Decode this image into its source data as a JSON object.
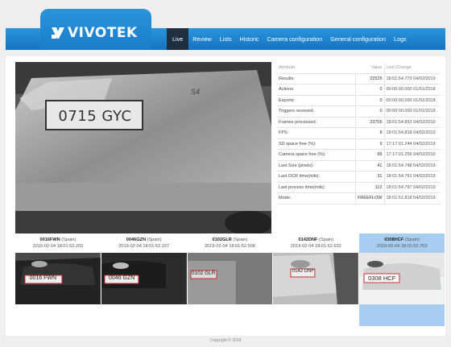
{
  "brand": {
    "name": "VIVOTEK"
  },
  "nav": [
    {
      "label": "Live",
      "active": true
    },
    {
      "label": "Review"
    },
    {
      "label": "Lists"
    },
    {
      "label": "Historic"
    },
    {
      "label": "Camera configuration"
    },
    {
      "label": "General configuration"
    },
    {
      "label": "Logs"
    }
  ],
  "video": {
    "plate_text": "0715 GYC",
    "badge_text": "S4"
  },
  "stats": {
    "headers": {
      "attribute": "Attribute",
      "value": "Value",
      "last_change": "Last Change"
    },
    "rows": [
      {
        "attribute": "Results:",
        "value": "22525",
        "last_change": "18:01:54.773 04/02/2019"
      },
      {
        "attribute": "Actions:",
        "value": "0",
        "last_change": "00:00:00.000 01/01/2018"
      },
      {
        "attribute": "Exports:",
        "value": "0",
        "last_change": "00:00:00.000 01/01/2018"
      },
      {
        "attribute": "Triggers received:",
        "value": "0",
        "last_change": "00:00:00.000 01/01/2018"
      },
      {
        "attribute": "Frames processed:",
        "value": "23706",
        "last_change": "18:01:54.892 04/02/2019"
      },
      {
        "attribute": "FPS:",
        "value": "8",
        "last_change": "18:01:54.818 04/02/2019"
      },
      {
        "attribute": "SD space free (%):",
        "value": "9",
        "last_change": "17:17:01.244 04/02/2019"
      },
      {
        "attribute": "Camera space free (%):",
        "value": "99",
        "last_change": "17:17:01.256 04/02/2019"
      },
      {
        "attribute": "Last Size (pixels):",
        "value": "41",
        "last_change": "18:01:54.748 04/02/2019"
      },
      {
        "attribute": "Last OCR time(mils):",
        "value": "31",
        "last_change": "18:01:54.761 04/02/2019"
      },
      {
        "attribute": "Last process time(mils):",
        "value": "112",
        "last_change": "18:01:54.797 04/02/2019"
      },
      {
        "attribute": "Mode:",
        "value": "FREEFLOW",
        "last_change": "18:01:51.818 04/02/2019"
      }
    ]
  },
  "plates": [
    {
      "code": "0016FWN",
      "country": "(Spain)",
      "time": "2019-02-04 18:01:52.203",
      "plate_text": "0016 FWN",
      "selected": false
    },
    {
      "code": "0046GZN",
      "country": "(Spain)",
      "time": "2019-02-04 18:01:52.337",
      "plate_text": "0046 GZN",
      "selected": false
    },
    {
      "code": "0102GLR",
      "country": "(Spain)",
      "time": "2019-02-04 18:01:52.508",
      "plate_text": "0102 GLR",
      "selected": false
    },
    {
      "code": "0142DNF",
      "country": "(Spain)",
      "time": "2019-02-04 18:01:52.632",
      "plate_text": "0142 DNF",
      "selected": false
    },
    {
      "code": "0308HCF",
      "country": "(Spain)",
      "time": "2019-02-04 18:01:52.753",
      "plate_text": "0308 HCF",
      "selected": true
    }
  ],
  "footer": {
    "copyright": "Copyright © 2018"
  }
}
